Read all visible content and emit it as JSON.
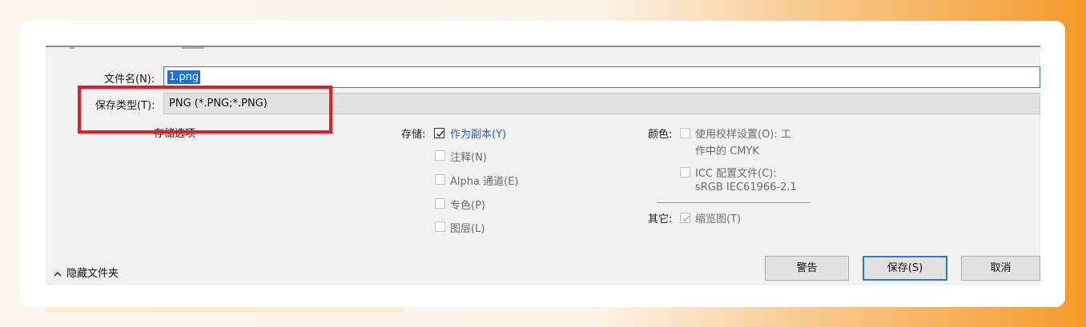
{
  "dialog": {
    "filename_label": "文件名(N):",
    "filename_value": "1.png",
    "filetype_label": "保存类型(T):",
    "filetype_value": "PNG (*.PNG;*.PNG)",
    "storage_options_label": "存储选项",
    "store_label": "存储:",
    "store_options": [
      {
        "label": "作为副本(Y)",
        "checked": true
      },
      {
        "label": "注释(N)",
        "checked": false
      },
      {
        "label": "Alpha 通道(E)",
        "checked": false
      },
      {
        "label": "专色(P)",
        "checked": false
      },
      {
        "label": "图层(L)",
        "checked": false
      }
    ],
    "color_label": "颜色:",
    "proof_setup_line1": "使用校样设置(O): 工",
    "proof_setup_line2": "作中的 CMYK",
    "icc_line1": "ICC 配置文件(C):",
    "icc_line2": "sRGB IEC61966-2.1",
    "other_label": "其它:",
    "thumbnail_label": "缩览图(T)",
    "hide_folders": "隐藏文件夹",
    "buttons": {
      "warning": "警告",
      "save": "保存(S)",
      "cancel": "取消"
    }
  },
  "colors": {
    "highlight_rect": "#e51c23",
    "selection": "#1e6fd6",
    "accent_text": "#1f5fbf"
  }
}
